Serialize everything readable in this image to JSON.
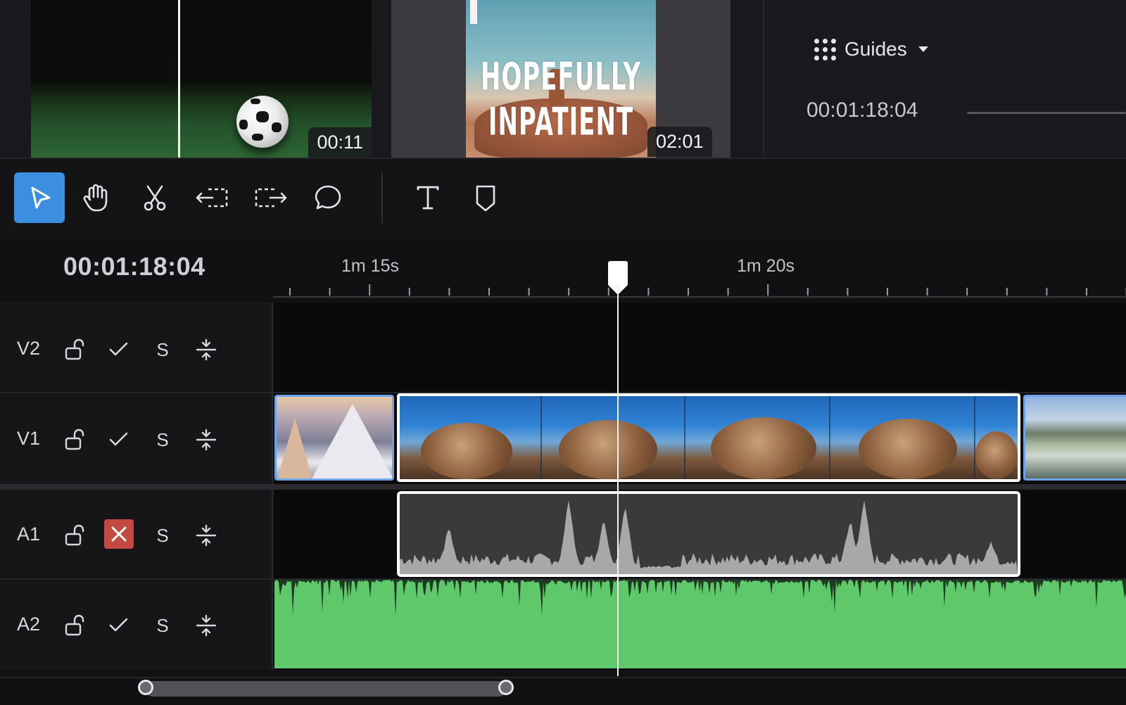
{
  "media": {
    "clip1_duration": "00:11",
    "clip2_duration": "02:01",
    "clip2_title": "HOPEFULLY INPATIENT"
  },
  "guides": {
    "label": "Guides",
    "icon": "grid-dots-icon",
    "timecode": "00:01:18:04"
  },
  "toolbar": {
    "tools": [
      {
        "name": "select-tool",
        "icon": "cursor-icon",
        "active": true
      },
      {
        "name": "hand-tool",
        "icon": "hand-icon"
      },
      {
        "name": "razor-tool",
        "icon": "scissors-icon"
      },
      {
        "name": "ripple-left-tool",
        "icon": "trim-left-icon"
      },
      {
        "name": "ripple-right-tool",
        "icon": "trim-right-icon"
      },
      {
        "name": "comment-tool",
        "icon": "speech-bubble-icon"
      },
      {
        "name": "text-tool",
        "icon": "text-icon"
      },
      {
        "name": "marker-tool",
        "icon": "shield-marker-icon"
      }
    ],
    "accent": "#3b8ee0"
  },
  "timeline": {
    "timecode": "00:01:18:04",
    "ruler_labels": [
      "1m 15s",
      "1m 20s"
    ]
  },
  "tracks": [
    {
      "id": "V2",
      "solo": "S",
      "enabled": true
    },
    {
      "id": "V1",
      "solo": "S",
      "enabled": true
    },
    {
      "id": "A1",
      "solo": "S",
      "enabled": false
    },
    {
      "id": "A2",
      "solo": "S",
      "enabled": true
    }
  ],
  "colors": {
    "audio_a2": "#5ec86a",
    "audio_disabled": "#c24a43",
    "clip_selected_border": "#ffffff",
    "clip_border": "#6fa3e8"
  }
}
